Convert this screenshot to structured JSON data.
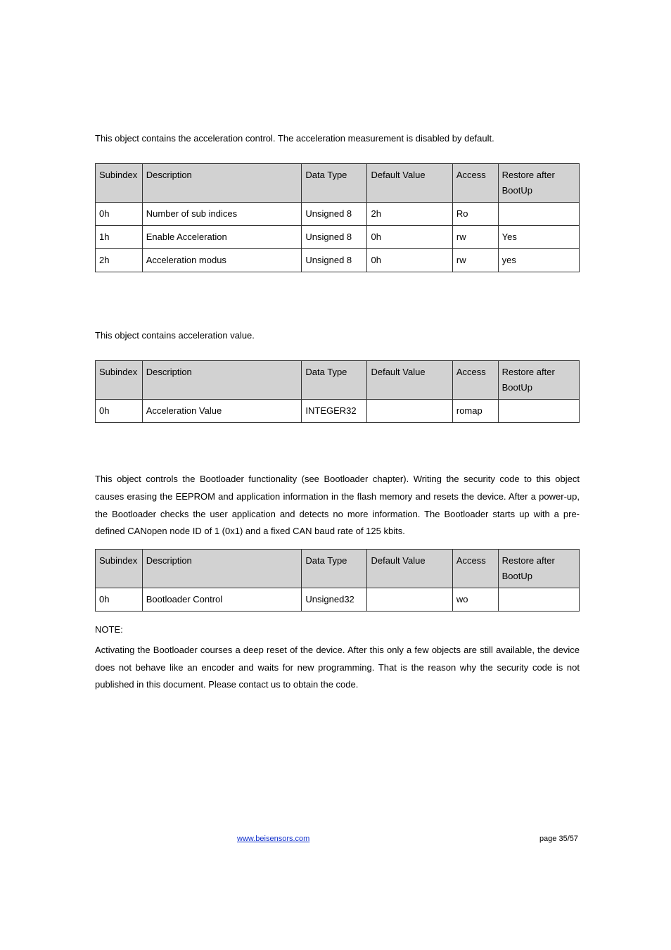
{
  "intro1": "This object contains the acceleration control. The acceleration measurement is disabled by default.",
  "table1": {
    "headers": [
      "Subindex",
      "Description",
      "Data Type",
      "Default Value",
      "Access",
      "Restore after BootUp"
    ],
    "rows": [
      [
        "0h",
        "Number of sub indices",
        "Unsigned 8",
        "2h",
        "Ro",
        ""
      ],
      [
        "1h",
        "Enable Acceleration",
        "Unsigned 8",
        "0h",
        "rw",
        "Yes"
      ],
      [
        "2h",
        "Acceleration modus",
        "Unsigned 8",
        "0h",
        "rw",
        "yes"
      ]
    ]
  },
  "intro2": "This object contains acceleration value.",
  "table2": {
    "headers": [
      "Subindex",
      "Description",
      "Data Type",
      "Default Value",
      "Access",
      "Restore after BootUp"
    ],
    "rows": [
      [
        "0h",
        "Acceleration Value",
        "INTEGER32",
        "",
        "romap",
        ""
      ]
    ]
  },
  "intro3": "This object controls the Bootloader functionality (see Bootloader chapter). Writing the security code to this object causes erasing the EEPROM and application information in the flash memory and resets the device. After a power-up, the Bootloader checks the user application and detects no more information. The Bootloader starts up with a pre-defined CANopen node ID of 1 (0x1) and a fixed CAN baud rate of 125 kbits.",
  "table3": {
    "headers": [
      "Subindex",
      "Description",
      "Data Type",
      "Default Value",
      "Access",
      "Restore after BootUp"
    ],
    "rows": [
      [
        "0h",
        "Bootloader Control",
        "Unsigned32",
        "",
        "wo",
        ""
      ]
    ]
  },
  "noteLabel": "NOTE:",
  "noteBody": "Activating the Bootloader courses a deep reset of the device. After this only a few objects are still available, the device does not behave like an encoder and waits for new programming. That is the reason why the security code is not published in this document. Please contact us to obtain the code.",
  "footerLink": "www.beisensors.com",
  "footerPage": "page 35/57"
}
